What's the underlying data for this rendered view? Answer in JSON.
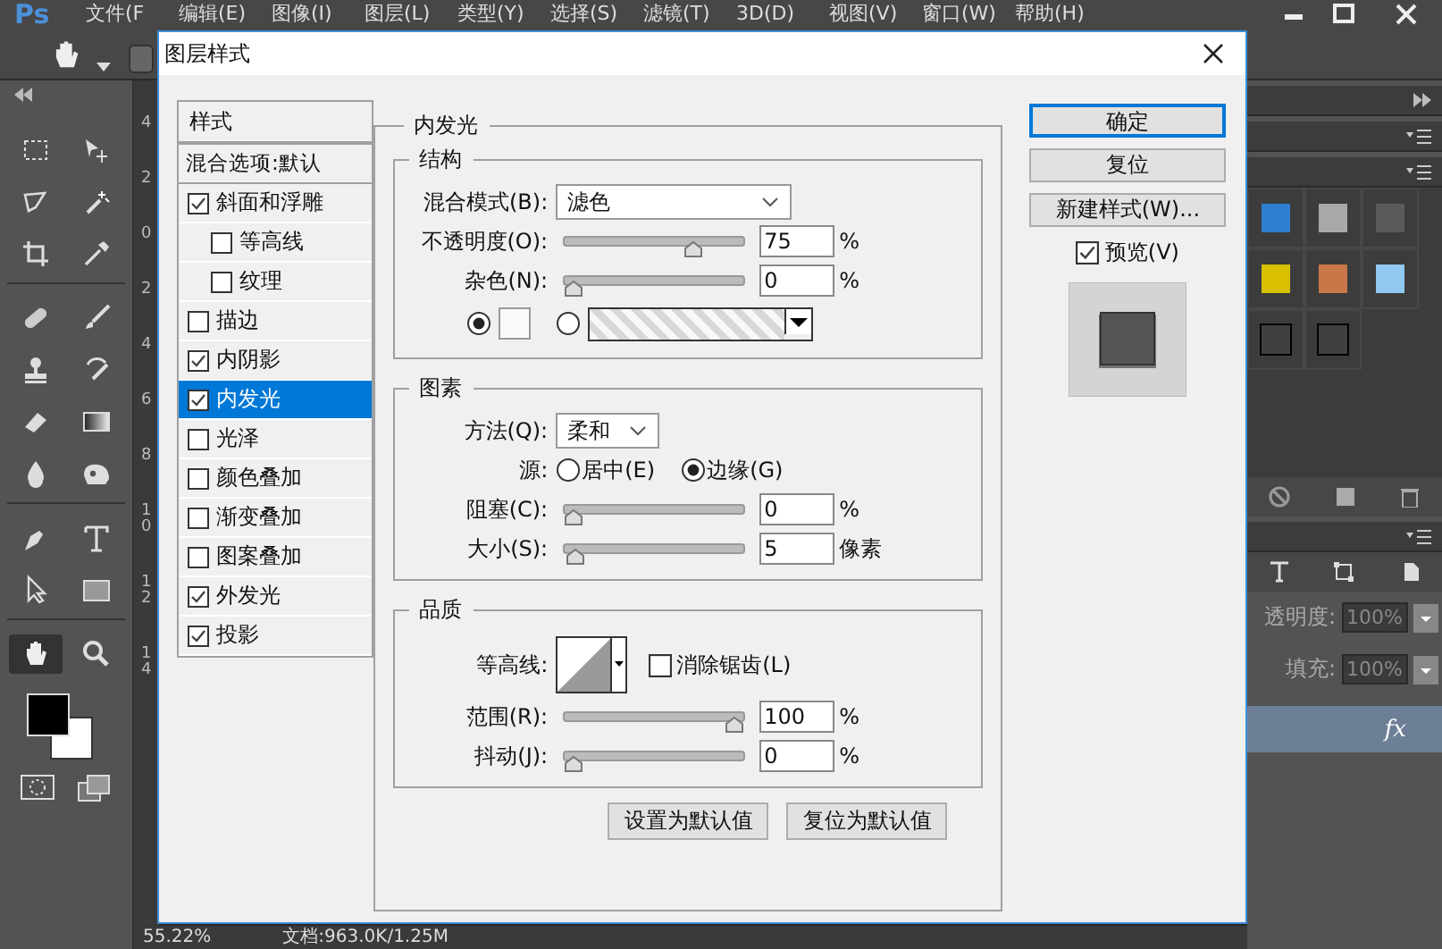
{
  "app": {
    "logo": "Ps",
    "menu": [
      "文件(F",
      "编辑(E)",
      "图像(I)",
      "图层(L)",
      "类型(Y)",
      "选择(S)",
      "滤镜(T)",
      "3D(D)",
      "视图(V)",
      "窗口(W)",
      "帮助(H)"
    ]
  },
  "toolbox": {
    "tools": [
      {
        "kind": "marquee",
        "selected": false
      },
      {
        "kind": "move",
        "selected": false
      },
      {
        "kind": "lasso",
        "selected": false
      },
      {
        "kind": "wand",
        "selected": false
      },
      {
        "kind": "crop",
        "selected": false
      },
      {
        "kind": "eyedropper",
        "selected": false
      },
      {
        "kind": "bandage",
        "selected": false
      },
      {
        "kind": "brush",
        "selected": false
      },
      {
        "kind": "stamp",
        "selected": false
      },
      {
        "kind": "history",
        "selected": false
      },
      {
        "kind": "eraser",
        "selected": false
      },
      {
        "kind": "gradient",
        "selected": false
      },
      {
        "kind": "drop",
        "selected": false
      },
      {
        "kind": "blob",
        "selected": false
      },
      {
        "kind": "pen",
        "selected": false
      },
      {
        "kind": "type",
        "selected": false
      },
      {
        "kind": "pointer",
        "selected": false
      },
      {
        "kind": "rectangle",
        "selected": false
      },
      {
        "kind": "hand",
        "selected": true
      },
      {
        "kind": "magnifier",
        "selected": false
      }
    ]
  },
  "ruler": {
    "labels": [
      "4",
      "2",
      "0",
      "2",
      "4",
      "6",
      "8",
      "10",
      "12",
      "14"
    ]
  },
  "status_bar": {
    "zoom": "55.22%",
    "document": "文档:963.0K/1.25M"
  },
  "styles_panel": {
    "swatches": [
      {
        "color": "#2f7fd0"
      },
      {
        "color": "#a8a8a8"
      },
      {
        "color": "#5a5a5a"
      },
      {
        "color": "#d8c000"
      },
      {
        "color": "#c87848"
      },
      {
        "color": "#90c8f0"
      },
      {
        "color": "#404040"
      },
      {
        "color": "#404040"
      }
    ]
  },
  "layers_panel": {
    "opacity_label": "透明度:",
    "opacity": "100%",
    "fill_label": "填充:",
    "fill": "100%",
    "layer_effect": "fx"
  },
  "dialog": {
    "title": "图层样式",
    "styles_header": "样式",
    "blend_options": "混合选项:默认",
    "styles": [
      {
        "label": "斜面和浮雕",
        "checked": true,
        "selected": false,
        "children": [
          {
            "label": "等高线",
            "checked": false,
            "selected": false
          },
          {
            "label": "纹理",
            "checked": false,
            "selected": false
          }
        ]
      },
      {
        "label": "描边",
        "checked": false,
        "selected": false
      },
      {
        "label": "内阴影",
        "checked": true,
        "selected": false
      },
      {
        "label": "内发光",
        "checked": true,
        "selected": true
      },
      {
        "label": "光泽",
        "checked": false,
        "selected": false
      },
      {
        "label": "颜色叠加",
        "checked": false,
        "selected": false
      },
      {
        "label": "渐变叠加",
        "checked": false,
        "selected": false
      },
      {
        "label": "图案叠加",
        "checked": false,
        "selected": false
      },
      {
        "label": "外发光",
        "checked": true,
        "selected": false
      },
      {
        "label": "投影",
        "checked": true,
        "selected": false
      }
    ],
    "panel_title": "内发光",
    "structure": {
      "title": "结构",
      "blend_mode_label": "混合模式(B):",
      "blend_mode": "滤色",
      "sliders": [
        {
          "label": "不透明度(O):",
          "level": 0.75,
          "value": "75",
          "unit": "%"
        },
        {
          "label": "杂色(N):",
          "level": 0,
          "value": "0",
          "unit": "%"
        }
      ],
      "fill_type": [
        {
          "kind": "color",
          "selected": true
        },
        {
          "kind": "gradient",
          "selected": false
        }
      ]
    },
    "elements": {
      "title": "图素",
      "method_label": "方法(Q):",
      "method": "柔和",
      "source_label": "源:",
      "source": [
        {
          "label": "居中(E)",
          "selected": false
        },
        {
          "label": "边缘(G)",
          "selected": true
        }
      ],
      "sliders": [
        {
          "label": "阻塞(C):",
          "level": 0,
          "value": "0",
          "unit": "%"
        },
        {
          "label": "大小(S):",
          "level": 0.02,
          "value": "5",
          "unit": "像素"
        }
      ]
    },
    "quality": {
      "title": "品质",
      "contour_label": "等高线:",
      "anti_alias": {
        "label": "消除锯齿(L)",
        "checked": false
      },
      "sliders": [
        {
          "label": "范围(R):",
          "level": 1,
          "value": "100",
          "unit": "%"
        },
        {
          "label": "抖动(J):",
          "level": 0,
          "value": "0",
          "unit": "%"
        }
      ]
    },
    "default_buttons": [
      "设置为默认值",
      "复位为默认值"
    ],
    "buttons": [
      {
        "label": "确定",
        "default": true
      },
      {
        "label": "复位",
        "default": false
      },
      {
        "label": "新建样式(W)...",
        "default": false
      }
    ],
    "preview": {
      "label": "预览(V)",
      "checked": true
    }
  }
}
